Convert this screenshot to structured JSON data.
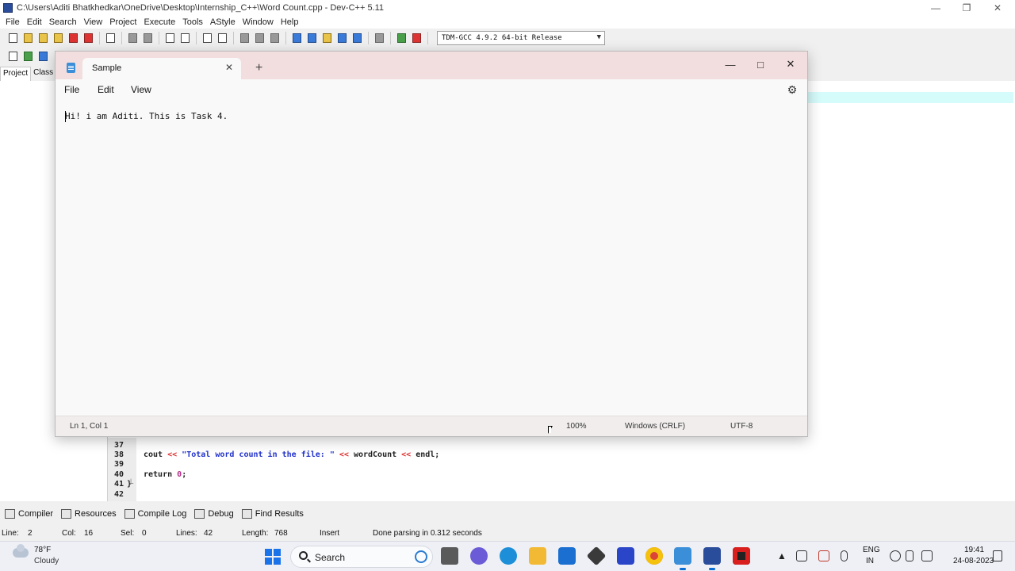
{
  "devcpp": {
    "title": "C:\\Users\\Aditi Bhatkhedkar\\OneDrive\\Desktop\\Internship_C++\\Word Count.cpp - Dev-C++ 5.11",
    "menu": [
      "File",
      "Edit",
      "Search",
      "View",
      "Project",
      "Execute",
      "Tools",
      "AStyle",
      "Window",
      "Help"
    ],
    "compiler": "TDM-GCC 4.9.2 64-bit Release",
    "left_tabs": [
      "Project",
      "Class"
    ],
    "code_lines": [
      {
        "num": "37",
        "code": ""
      },
      {
        "num": "38",
        "code": "cout << \"Total word count in the file: \" << wordCount << endl;"
      },
      {
        "num": "39",
        "code": ""
      },
      {
        "num": "40",
        "code": "return 0;"
      },
      {
        "num": "41",
        "code": "}"
      },
      {
        "num": "42",
        "code": ""
      }
    ],
    "bottom_tabs": [
      "Compiler",
      "Resources",
      "Compile Log",
      "Debug",
      "Find Results"
    ],
    "status": {
      "line_label": "Line:",
      "line_value": "2",
      "col_label": "Col:",
      "col_value": "16",
      "sel_label": "Sel:",
      "sel_value": "0",
      "lines_label": "Lines:",
      "lines_value": "42",
      "length_label": "Length:",
      "length_value": "768",
      "mode": "Insert",
      "message": "Done parsing in 0.312 seconds"
    }
  },
  "notepad": {
    "tab_title": "Sample",
    "menu": [
      "File",
      "Edit",
      "View"
    ],
    "text": "Hi! i am Aditi. This is Task 4.",
    "status": {
      "position": "Ln 1, Col 1",
      "zoom": "100%",
      "line_ending": "Windows (CRLF)",
      "encoding": "UTF-8"
    }
  },
  "taskbar": {
    "weather_temp": "78°F",
    "weather_desc": "Cloudy",
    "search_label": "Search",
    "lang_top": "ENG",
    "lang_bottom": "IN",
    "time": "19:41",
    "date": "24-08-2023"
  },
  "colors": {
    "notepad_titlebar": "#f2dede",
    "accent": "#1a73e8"
  }
}
